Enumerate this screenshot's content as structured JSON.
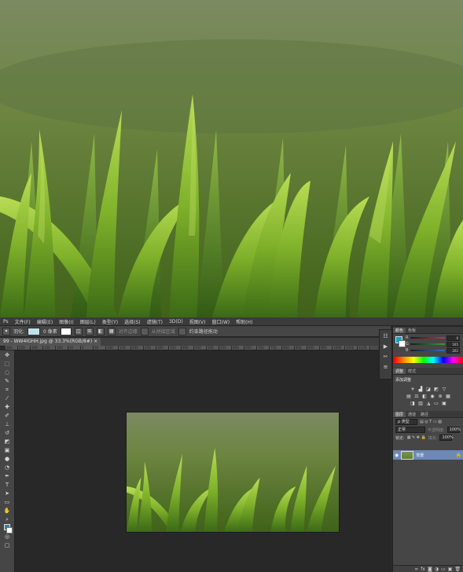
{
  "menu": [
    "文件(F)",
    "编辑(E)",
    "图像(I)",
    "图层(L)",
    "类型(Y)",
    "选择(S)",
    "滤镜(T)",
    "3D(D)",
    "视图(V)",
    "窗口(W)",
    "帮助(H)"
  ],
  "options": {
    "feather_label": "羽化:",
    "feather_value": "0 像素",
    "align_label": "对齐边缘",
    "auto_label": "从拼接区域",
    "transform_label": "约束路径拖动"
  },
  "doc_tab": "99 - WW4IGHH.jpg @ 33.3%(RGB/8#)",
  "ruler_marks": [
    "300",
    "250",
    "200",
    "150",
    "100",
    "50",
    "0",
    "50",
    "100",
    "150",
    "200",
    "250",
    "300",
    "350",
    "400",
    "450",
    "500",
    "550",
    "600",
    "650",
    "700",
    "750",
    "800",
    "850",
    "900",
    "950",
    "1000",
    "1050",
    "1100",
    "1150",
    "1200",
    "1250",
    "1300"
  ],
  "tools": [
    "move",
    "marquee",
    "lasso",
    "quick-select",
    "crop",
    "eyedropper",
    "heal",
    "brush",
    "stamp",
    "history",
    "eraser",
    "gradient",
    "blur",
    "dodge",
    "pen",
    "type",
    "path-select",
    "shape",
    "hand",
    "zoom",
    "colors",
    "quickmask",
    "screen-mode"
  ],
  "color_panel": {
    "tabs": [
      "颜色",
      "色板"
    ],
    "r_label": "R",
    "g_label": "G",
    "b_label": "B",
    "r_value": "0",
    "g_value": "165",
    "b_value": "202",
    "r_color": "#c7334e",
    "g_color": "#3f9a3f",
    "b_color": "#2f6fd0"
  },
  "adjust_panel": {
    "tabs": [
      "调整",
      "样式"
    ],
    "title": "添加调整"
  },
  "layers_panel": {
    "tabs": [
      "图层",
      "通道",
      "路径"
    ],
    "kind": "ρ 类型",
    "blend": "正常",
    "opacity_label": "不透明度:",
    "opacity": "100%",
    "lock_label": "锁定:",
    "fill_label": "填充:",
    "fill": "100%",
    "layer_name": "背景"
  },
  "colors": {
    "accent": "#6d89b7"
  }
}
